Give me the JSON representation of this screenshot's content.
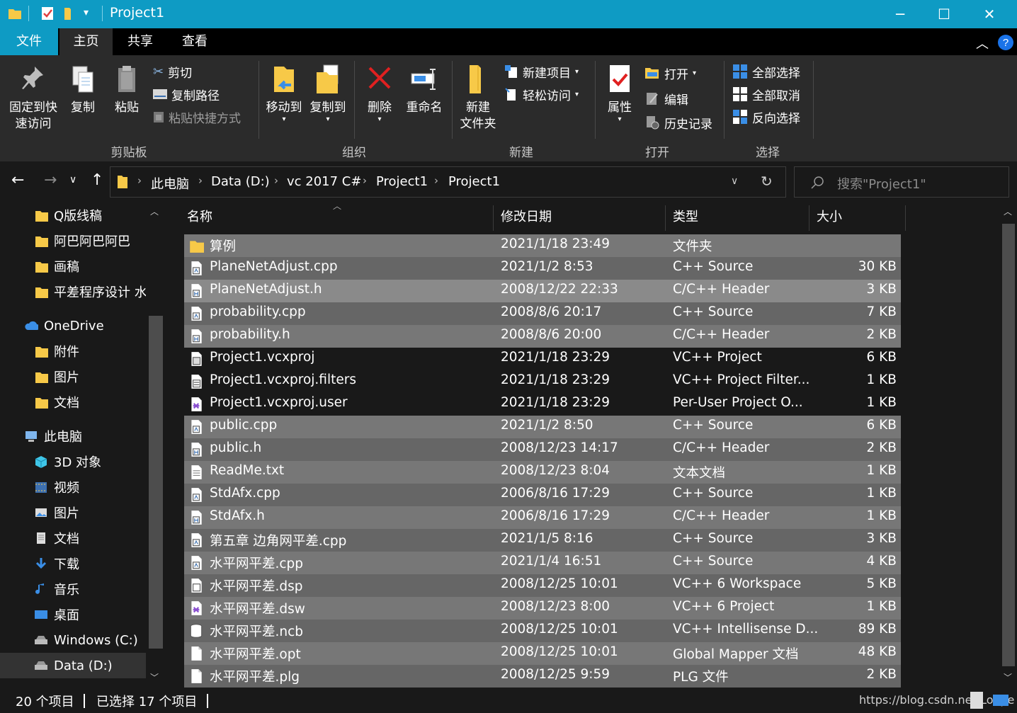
{
  "window": {
    "title": "Project1"
  },
  "ribbon_tabs": [
    "文件",
    "主页",
    "共享",
    "查看"
  ],
  "clipboard": {
    "pin": "固定到快\n速访问",
    "copy": "复制",
    "paste": "粘贴",
    "cut": "剪切",
    "copy_path": "复制路径",
    "paste_shortcut": "粘贴快捷方式",
    "group": "剪贴板"
  },
  "organize": {
    "move_to": "移动到",
    "copy_to": "复制到",
    "delete": "删除",
    "rename": "重命名",
    "group": "组织"
  },
  "new": {
    "new_folder": "新建\n文件夹",
    "new_item": "新建项目",
    "easy_access": "轻松访问",
    "group": "新建"
  },
  "open": {
    "properties": "属性",
    "open": "打开",
    "edit": "编辑",
    "history": "历史记录",
    "group": "打开"
  },
  "select": {
    "select_all": "全部选择",
    "select_none": "全部取消",
    "invert": "反向选择",
    "group": "选择"
  },
  "breadcrumb": [
    "此电脑",
    "Data (D:)",
    "vc 2017 C#",
    "Project1",
    "Project1"
  ],
  "search": {
    "placeholder": "搜索\"Project1\""
  },
  "nav": [
    {
      "label": "Q版线稿",
      "icon": "folder-icon"
    },
    {
      "label": "阿巴阿巴阿巴",
      "icon": "folder-icon"
    },
    {
      "label": "画稿",
      "icon": "folder-icon"
    },
    {
      "label": "平差程序设计 水",
      "icon": "folder-icon"
    },
    {
      "label": "OneDrive",
      "icon": "cloud-icon"
    },
    {
      "label": "附件",
      "icon": "folder-icon"
    },
    {
      "label": "图片",
      "icon": "folder-icon"
    },
    {
      "label": "文档",
      "icon": "folder-icon"
    },
    {
      "label": "此电脑",
      "icon": "computer-icon"
    },
    {
      "label": "3D 对象",
      "icon": "cube-icon"
    },
    {
      "label": "视频",
      "icon": "video-icon"
    },
    {
      "label": "图片",
      "icon": "pictures-icon"
    },
    {
      "label": "文档",
      "icon": "documents-icon"
    },
    {
      "label": "下载",
      "icon": "download-icon"
    },
    {
      "label": "音乐",
      "icon": "music-icon"
    },
    {
      "label": "桌面",
      "icon": "desktop-icon"
    },
    {
      "label": "Windows (C:)",
      "icon": "drive-icon"
    },
    {
      "label": "Data (D:)",
      "icon": "drive-icon"
    }
  ],
  "columns": [
    "名称",
    "修改日期",
    "类型",
    "大小"
  ],
  "files": [
    {
      "name": "算例",
      "date": "2021/1/18 23:49",
      "type": "文件夹",
      "size": "",
      "icon": "folder-icon",
      "selected": true
    },
    {
      "name": "PlaneNetAdjust.cpp",
      "date": "2021/1/2 8:53",
      "type": "C++ Source",
      "size": "30 KB",
      "icon": "cpp-file-icon",
      "selected": true
    },
    {
      "name": "PlaneNetAdjust.h",
      "date": "2008/12/22 22:33",
      "type": "C/C++ Header",
      "size": "3 KB",
      "icon": "header-file-icon",
      "selected": true
    },
    {
      "name": "probability.cpp",
      "date": "2008/8/6 20:17",
      "type": "C++ Source",
      "size": "7 KB",
      "icon": "cpp-file-icon",
      "selected": true
    },
    {
      "name": "probability.h",
      "date": "2008/8/6 20:00",
      "type": "C/C++ Header",
      "size": "2 KB",
      "icon": "header-file-icon",
      "selected": true
    },
    {
      "name": "Project1.vcxproj",
      "date": "2021/1/18 23:29",
      "type": "VC++ Project",
      "size": "6 KB",
      "icon": "vcxproj-file-icon",
      "selected": false
    },
    {
      "name": "Project1.vcxproj.filters",
      "date": "2021/1/18 23:29",
      "type": "VC++ Project Filter...",
      "size": "1 KB",
      "icon": "filters-file-icon",
      "selected": false
    },
    {
      "name": "Project1.vcxproj.user",
      "date": "2021/1/18 23:29",
      "type": "Per-User Project O...",
      "size": "1 KB",
      "icon": "vs-file-icon",
      "selected": false
    },
    {
      "name": "public.cpp",
      "date": "2021/1/2 8:50",
      "type": "C++ Source",
      "size": "6 KB",
      "icon": "cpp-file-icon",
      "selected": true
    },
    {
      "name": "public.h",
      "date": "2008/12/23 14:17",
      "type": "C/C++ Header",
      "size": "2 KB",
      "icon": "header-file-icon",
      "selected": true
    },
    {
      "name": "ReadMe.txt",
      "date": "2008/12/23 8:04",
      "type": "文本文档",
      "size": "1 KB",
      "icon": "text-file-icon",
      "selected": true
    },
    {
      "name": "StdAfx.cpp",
      "date": "2006/8/16 17:29",
      "type": "C++ Source",
      "size": "1 KB",
      "icon": "cpp-file-icon",
      "selected": true
    },
    {
      "name": "StdAfx.h",
      "date": "2006/8/16 17:29",
      "type": "C/C++ Header",
      "size": "1 KB",
      "icon": "header-file-icon",
      "selected": true
    },
    {
      "name": "第五章 边角网平差.cpp",
      "date": "2021/1/5 8:16",
      "type": "C++ Source",
      "size": "3 KB",
      "icon": "cpp-file-icon",
      "selected": true
    },
    {
      "name": "水平网平差.cpp",
      "date": "2021/1/4 16:51",
      "type": "C++ Source",
      "size": "4 KB",
      "icon": "cpp-file-icon",
      "selected": true
    },
    {
      "name": "水平网平差.dsp",
      "date": "2008/12/25 10:01",
      "type": "VC++ 6 Workspace",
      "size": "5 KB",
      "icon": "dsp-file-icon",
      "selected": true
    },
    {
      "name": "水平网平差.dsw",
      "date": "2008/12/23 8:00",
      "type": "VC++ 6 Project",
      "size": "1 KB",
      "icon": "vs-file-icon",
      "selected": true
    },
    {
      "name": "水平网平差.ncb",
      "date": "2008/12/25 10:01",
      "type": "VC++ Intellisense D...",
      "size": "89 KB",
      "icon": "database-file-icon",
      "selected": true
    },
    {
      "name": "水平网平差.opt",
      "date": "2008/12/25 10:01",
      "type": "Global Mapper 文档",
      "size": "48 KB",
      "icon": "generic-file-icon",
      "selected": true
    },
    {
      "name": "水平网平差.plg",
      "date": "2008/12/25 9:59",
      "type": "PLG 文件",
      "size": "2 KB",
      "icon": "generic-file-icon",
      "selected": true
    }
  ],
  "status": {
    "count": "20 个项目",
    "selected": "已选择 17 个项目"
  },
  "watermark": "https://blog.csdn.net/Loope",
  "colors": {
    "accent": "#0e9bc4",
    "selection": "#777777"
  }
}
